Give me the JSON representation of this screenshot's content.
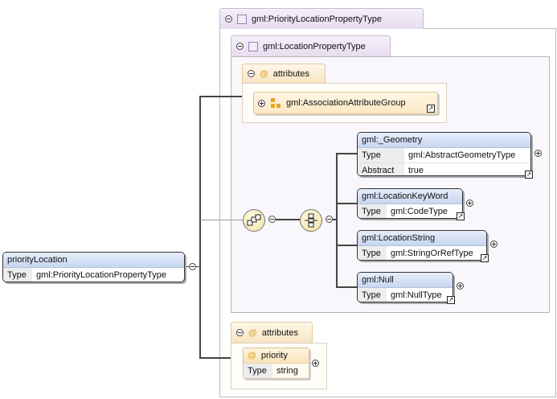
{
  "outer_type": {
    "name": "gml:PriorityLocationPropertyType"
  },
  "inner_type": {
    "name": "gml:LocationPropertyType"
  },
  "inner_attributes": {
    "label": "attributes",
    "group_ref": "gml:AssociationAttributeGroup"
  },
  "choice_elements": [
    {
      "name": "gml:_Geometry",
      "type_key": "Type",
      "type": "gml:AbstractGeometryType",
      "abstract_key": "Abstract",
      "abstract": "true"
    },
    {
      "name": "gml:LocationKeyWord",
      "type_key": "Type",
      "type": "gml:CodeType"
    },
    {
      "name": "gml:LocationString",
      "type_key": "Type",
      "type": "gml:StringOrRefType"
    },
    {
      "name": "gml:Null",
      "type_key": "Type",
      "type": "gml:NullType"
    }
  ],
  "outer_attributes": {
    "label": "attributes",
    "attribute": {
      "at": "@",
      "name": "priority",
      "type_key": "Type",
      "type": "string"
    }
  },
  "root_element": {
    "name": "priorityLocation",
    "type_key": "Type",
    "type": "gml:PriorityLocationPropertyType"
  },
  "icons": {
    "at": "@",
    "link": "↗"
  },
  "colors": {
    "element_header": "#c7d6f1",
    "attr_header": "#f8e3bc",
    "complex_type_tab": "#e7dcef",
    "at_symbol": "#e3a52b"
  }
}
